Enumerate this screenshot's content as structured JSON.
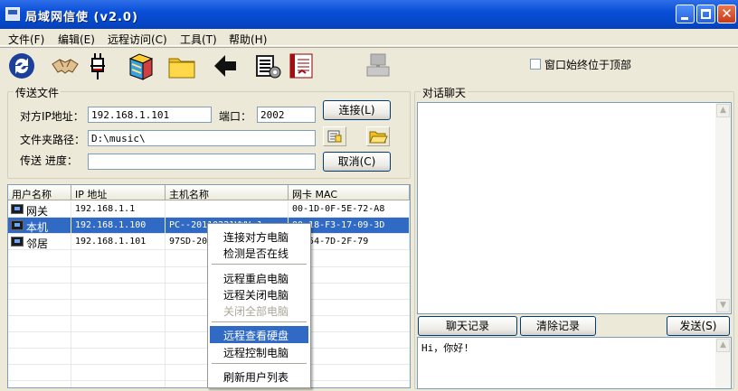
{
  "window": {
    "title": "局域网信使 (v2.0)"
  },
  "menu": [
    "文件(F)",
    "编辑(E)",
    "远程访问(C)",
    "工具(T)",
    "帮助(H)"
  ],
  "toolbar": {
    "pin_label": "窗口始终位于顶部",
    "pin_checked": false,
    "tools": [
      "refresh-icon",
      "handshake-icon",
      "plug-icon",
      "books-icon",
      "folder-icon",
      "back-arrow-icon",
      "gear-book-icon",
      "notebook-icon",
      "computer-gray-icon"
    ]
  },
  "transfer": {
    "group_label": "传送文件",
    "ip_label": "对方IP地址：",
    "ip_value": "192.168.1.101",
    "port_label": "端口：",
    "port_value": "2002",
    "connect_button": "连接(L)",
    "folder_label": "文件夹路径：",
    "folder_value": "D:\\music\\",
    "progress_label": "传送 进度：",
    "cancel_button": "取消(C)"
  },
  "users": {
    "columns": [
      "用户名称",
      "IP 地址",
      "主机名称",
      "网卡 MAC"
    ],
    "rows": [
      {
        "name": "网关",
        "ip": "192.168.1.1",
        "host": "",
        "mac": "00-1D-0F-5E-72-A8"
      },
      {
        "name": "本机",
        "ip": "192.168.1.100",
        "host": "PC--20110221VWV J",
        "mac": "00-18-F3-17-09-3D",
        "selected": true
      },
      {
        "name": "邻居",
        "ip": "192.168.1.101",
        "host": "97SD-20",
        "mac": "24-54-7D-2F-79"
      }
    ]
  },
  "context_menu": {
    "items": [
      {
        "label": "连接对方电脑"
      },
      {
        "label": "检测是否在线"
      },
      {
        "label": "远程重启电脑"
      },
      {
        "label": "远程关闭电脑"
      },
      {
        "label": "关闭全部电脑",
        "disabled": true
      },
      {
        "label": "远程查看硬盘",
        "highlighted": true
      },
      {
        "label": "远程控制电脑"
      },
      {
        "label": "刷新用户列表"
      }
    ]
  },
  "chat": {
    "group_label": "对话聊天",
    "history_button": "聊天记录",
    "clear_button": "清除记录",
    "send_button": "发送(S)",
    "input_value": "Hi，你好!"
  }
}
